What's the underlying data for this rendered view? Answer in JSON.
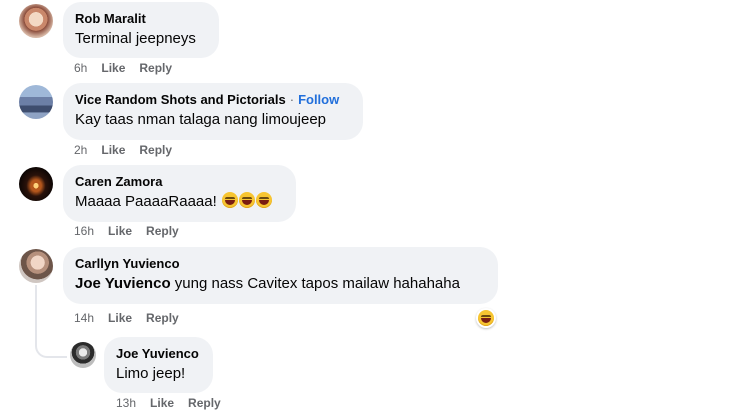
{
  "comments": [
    {
      "author": "Rob Maralit",
      "text": "Terminal jeepneys",
      "time": "6h",
      "like": "Like",
      "reply": "Reply"
    },
    {
      "author": "Vice Random Shots and Pictorials",
      "follow_sep": "·",
      "follow": "Follow",
      "text": "Kay taas nman talaga nang limoujeep",
      "time": "2h",
      "like": "Like",
      "reply": "Reply"
    },
    {
      "author": "Caren Zamora",
      "text": "Maaaa PaaaaRaaaa!",
      "emojis": [
        "laughing-face-icon",
        "laughing-face-icon",
        "laughing-face-icon"
      ],
      "time": "16h",
      "like": "Like",
      "reply": "Reply"
    },
    {
      "author": "Carllyn Yuvienco",
      "mention": "Joe Yuvienco",
      "text": "yung nass Cavitex tapos mailaw hahahaha",
      "reaction_icon": "laughing-face-icon",
      "time": "14h",
      "like": "Like",
      "reply": "Reply"
    },
    {
      "author": "Joe Yuvienco",
      "text": "Limo jeep!",
      "time": "13h",
      "like": "Like",
      "reply": "Reply"
    }
  ],
  "colors": {
    "bubble": "#f0f2f5",
    "follow": "#216fdb",
    "meta": "#65676b",
    "emoji": "#f7c531"
  }
}
